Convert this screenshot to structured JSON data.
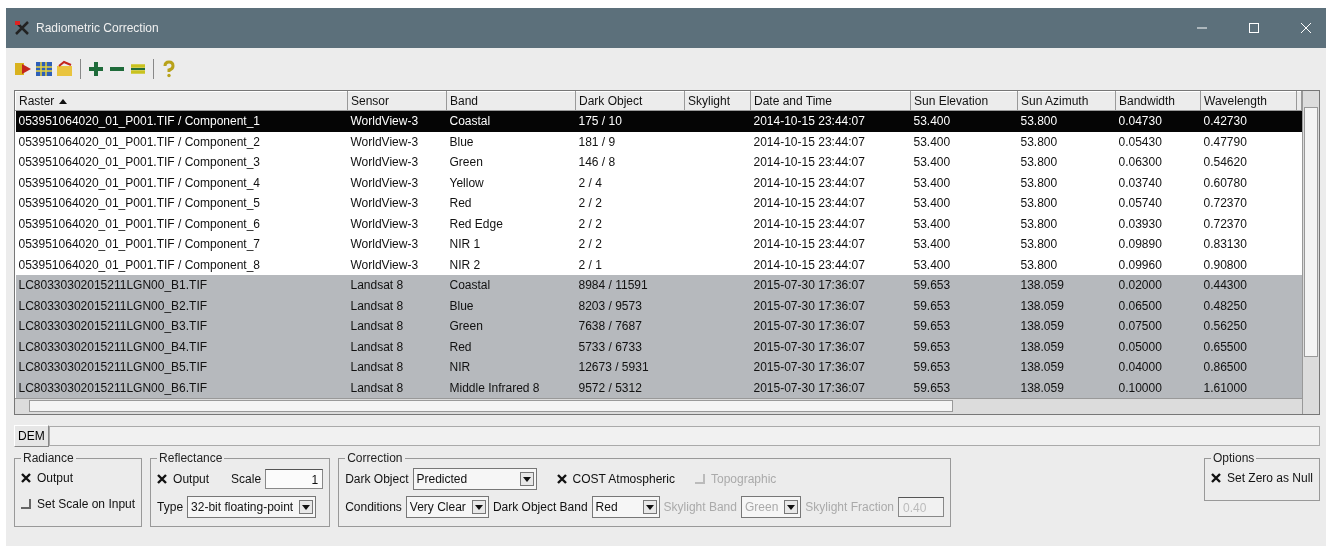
{
  "window": {
    "title": "Radiometric Correction"
  },
  "table": {
    "columns": [
      {
        "label": "Raster",
        "sorted": true
      },
      {
        "label": "Sensor",
        "sorted": false
      },
      {
        "label": "Band",
        "sorted": false
      },
      {
        "label": "Dark Object",
        "sorted": false
      },
      {
        "label": "Skylight",
        "sorted": false
      },
      {
        "label": "Date and Time",
        "sorted": false
      },
      {
        "label": "Sun Elevation",
        "sorted": false
      },
      {
        "label": "Sun Azimuth",
        "sorted": false
      },
      {
        "label": "Bandwidth",
        "sorted": false
      },
      {
        "label": "Wavelength",
        "sorted": false
      }
    ],
    "rows": [
      {
        "selected": true,
        "shaded": false,
        "cells": [
          "053951064020_01_P001.TIF / Component_1",
          "WorldView-3",
          "Coastal",
          "175 / 10",
          "",
          "2014-10-15 23:44:07",
          "53.400",
          "53.800",
          "0.04730",
          "0.42730"
        ]
      },
      {
        "selected": false,
        "shaded": false,
        "cells": [
          "053951064020_01_P001.TIF / Component_2",
          "WorldView-3",
          "Blue",
          "181 / 9",
          "",
          "2014-10-15 23:44:07",
          "53.400",
          "53.800",
          "0.05430",
          "0.47790"
        ]
      },
      {
        "selected": false,
        "shaded": false,
        "cells": [
          "053951064020_01_P001.TIF / Component_3",
          "WorldView-3",
          "Green",
          "146 / 8",
          "",
          "2014-10-15 23:44:07",
          "53.400",
          "53.800",
          "0.06300",
          "0.54620"
        ]
      },
      {
        "selected": false,
        "shaded": false,
        "cells": [
          "053951064020_01_P001.TIF / Component_4",
          "WorldView-3",
          "Yellow",
          "2 / 4",
          "",
          "2014-10-15 23:44:07",
          "53.400",
          "53.800",
          "0.03740",
          "0.60780"
        ]
      },
      {
        "selected": false,
        "shaded": false,
        "cells": [
          "053951064020_01_P001.TIF / Component_5",
          "WorldView-3",
          "Red",
          "2 / 2",
          "",
          "2014-10-15 23:44:07",
          "53.400",
          "53.800",
          "0.05740",
          "0.72370"
        ]
      },
      {
        "selected": false,
        "shaded": false,
        "cells": [
          "053951064020_01_P001.TIF / Component_6",
          "WorldView-3",
          "Red Edge",
          "2 / 2",
          "",
          "2014-10-15 23:44:07",
          "53.400",
          "53.800",
          "0.03930",
          "0.72370"
        ]
      },
      {
        "selected": false,
        "shaded": false,
        "cells": [
          "053951064020_01_P001.TIF / Component_7",
          "WorldView-3",
          "NIR 1",
          "2 / 2",
          "",
          "2014-10-15 23:44:07",
          "53.400",
          "53.800",
          "0.09890",
          "0.83130"
        ]
      },
      {
        "selected": false,
        "shaded": false,
        "cells": [
          "053951064020_01_P001.TIF / Component_8",
          "WorldView-3",
          "NIR 2",
          "2 / 1",
          "",
          "2014-10-15 23:44:07",
          "53.400",
          "53.800",
          "0.09960",
          "0.90800"
        ]
      },
      {
        "selected": false,
        "shaded": true,
        "cells": [
          "LC80330302015211LGN00_B1.TIF",
          "Landsat 8",
          "Coastal",
          "8984 / 11591",
          "",
          "2015-07-30 17:36:07",
          "59.653",
          "138.059",
          "0.02000",
          "0.44300"
        ]
      },
      {
        "selected": false,
        "shaded": true,
        "cells": [
          "LC80330302015211LGN00_B2.TIF",
          "Landsat 8",
          "Blue",
          "8203 / 9573",
          "",
          "2015-07-30 17:36:07",
          "59.653",
          "138.059",
          "0.06500",
          "0.48250"
        ]
      },
      {
        "selected": false,
        "shaded": true,
        "cells": [
          "LC80330302015211LGN00_B3.TIF",
          "Landsat 8",
          "Green",
          "7638 / 7687",
          "",
          "2015-07-30 17:36:07",
          "59.653",
          "138.059",
          "0.07500",
          "0.56250"
        ]
      },
      {
        "selected": false,
        "shaded": true,
        "cells": [
          "LC80330302015211LGN00_B4.TIF",
          "Landsat 8",
          "Red",
          "5733 / 6733",
          "",
          "2015-07-30 17:36:07",
          "59.653",
          "138.059",
          "0.05000",
          "0.65500"
        ]
      },
      {
        "selected": false,
        "shaded": true,
        "cells": [
          "LC80330302015211LGN00_B5.TIF",
          "Landsat 8",
          "NIR",
          "12673 / 5931",
          "",
          "2015-07-30 17:36:07",
          "59.653",
          "138.059",
          "0.04000",
          "0.86500"
        ]
      },
      {
        "selected": false,
        "shaded": true,
        "cells": [
          "LC80330302015211LGN00_B6.TIF",
          "Landsat 8",
          "Middle Infrared 8",
          "9572 / 5312",
          "",
          "2015-07-30 17:36:07",
          "59.653",
          "138.059",
          "0.10000",
          "1.61000"
        ]
      }
    ]
  },
  "dem": {
    "label": "DEM"
  },
  "radiance": {
    "title": "Radiance",
    "options": [
      {
        "label": "Output",
        "checked": true
      },
      {
        "label": "Set Scale on Input",
        "checked": false
      }
    ]
  },
  "reflectance": {
    "title": "Reflectance",
    "output": {
      "label": "Output",
      "checked": true
    },
    "scale": {
      "label": "Scale",
      "value": "1"
    },
    "type": {
      "label": "Type",
      "value": "32-bit floating-point"
    }
  },
  "correction": {
    "title": "Correction",
    "dark_object": {
      "label": "Dark Object",
      "value": "Predicted",
      "disabled": false
    },
    "cost": {
      "label": "COST Atmospheric",
      "checked": true,
      "disabled": false
    },
    "topographic": {
      "label": "Topographic",
      "checked": false,
      "disabled": true
    },
    "conditions": {
      "label": "Conditions",
      "value": "Very Clear",
      "disabled": false
    },
    "dark_object_band": {
      "label": "Dark Object Band",
      "value": "Red",
      "disabled": false
    },
    "skylight_band": {
      "label": "Skylight Band",
      "value": "Green",
      "disabled": true
    },
    "skylight_fraction": {
      "label": "Skylight Fraction",
      "value": "0.40",
      "disabled": true
    }
  },
  "options": {
    "title": "Options",
    "set_zero": {
      "label": "Set Zero as Null",
      "checked": true
    }
  }
}
